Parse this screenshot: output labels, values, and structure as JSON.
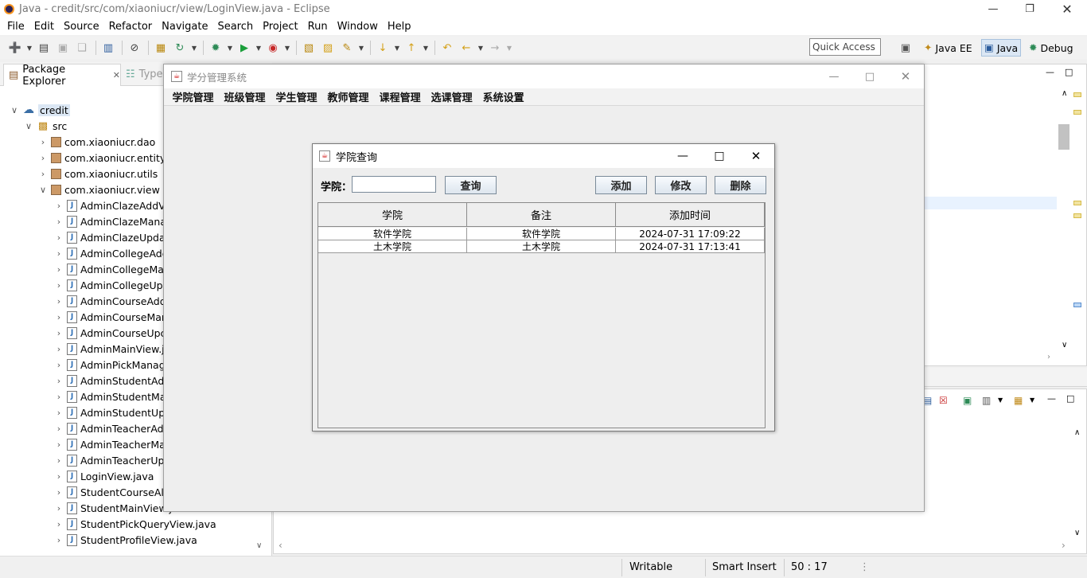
{
  "eclipse": {
    "title": "Java - credit/src/com/xiaoniucr/view/LoginView.java - Eclipse",
    "window_controls": [
      "minimize-icon",
      "restore-icon",
      "close-icon"
    ],
    "menu": [
      "File",
      "Edit",
      "Source",
      "Refactor",
      "Navigate",
      "Search",
      "Project",
      "Run",
      "Window",
      "Help"
    ],
    "quick_access": "Quick Access",
    "perspectives": [
      "Java EE",
      "Java",
      "Debug"
    ],
    "package_explorer": {
      "tab_label": "Package Explorer",
      "other_tab_label": "Type",
      "tree": [
        {
          "label": "credit",
          "kind": "project"
        },
        {
          "label": "src",
          "kind": "folder"
        },
        {
          "label": "com.xiaoniucr.dao",
          "kind": "package"
        },
        {
          "label": "com.xiaoniucr.entity",
          "kind": "package"
        },
        {
          "label": "com.xiaoniucr.utils",
          "kind": "package"
        },
        {
          "label": "com.xiaoniucr.view",
          "kind": "package"
        },
        {
          "label": "AdminClazeAddV",
          "kind": "file"
        },
        {
          "label": "AdminClazeMana",
          "kind": "file"
        },
        {
          "label": "AdminClazeUpda",
          "kind": "file"
        },
        {
          "label": "AdminCollegeAdc",
          "kind": "file"
        },
        {
          "label": "AdminCollegeMa",
          "kind": "file"
        },
        {
          "label": "AdminCollegeUpc",
          "kind": "file"
        },
        {
          "label": "AdminCourseAdd",
          "kind": "file"
        },
        {
          "label": "AdminCourseMar",
          "kind": "file"
        },
        {
          "label": "AdminCourseUpc",
          "kind": "file"
        },
        {
          "label": "AdminMainView.j",
          "kind": "file"
        },
        {
          "label": "AdminPickManag",
          "kind": "file"
        },
        {
          "label": "AdminStudentAdc",
          "kind": "file"
        },
        {
          "label": "AdminStudentMa",
          "kind": "file"
        },
        {
          "label": "AdminStudentUpc",
          "kind": "file"
        },
        {
          "label": "AdminTeacherAd",
          "kind": "file"
        },
        {
          "label": "AdminTeacherMa",
          "kind": "file"
        },
        {
          "label": "AdminTeacherUp",
          "kind": "file"
        },
        {
          "label": "LoginView.java",
          "kind": "file"
        },
        {
          "label": "StudentCourseAll",
          "kind": "file"
        },
        {
          "label": "StudentMainView.java",
          "kind": "file"
        },
        {
          "label": "StudentPickQueryView.java",
          "kind": "file"
        },
        {
          "label": "StudentProfileView.java",
          "kind": "file"
        }
      ]
    },
    "status": {
      "writable": "Writable",
      "insert_mode": "Smart Insert",
      "position": "50 : 17"
    }
  },
  "app": {
    "title": "学分管理系统",
    "menu": [
      "学院管理",
      "班级管理",
      "学生管理",
      "教师管理",
      "课程管理",
      "选课管理",
      "系统设置"
    ],
    "dialog": {
      "title": "学院查询",
      "search_label": "学院：",
      "search_value": "",
      "query_button": "查询",
      "add_button": "添加",
      "edit_button": "修改",
      "delete_button": "删除",
      "table": {
        "columns": [
          "学院",
          "备注",
          "添加时间"
        ],
        "rows": [
          [
            "软件学院",
            "软件学院",
            "2024-07-31 17:09:22"
          ],
          [
            "土木学院",
            "土木学院",
            "2024-07-31 17:13:41"
          ]
        ]
      }
    }
  }
}
